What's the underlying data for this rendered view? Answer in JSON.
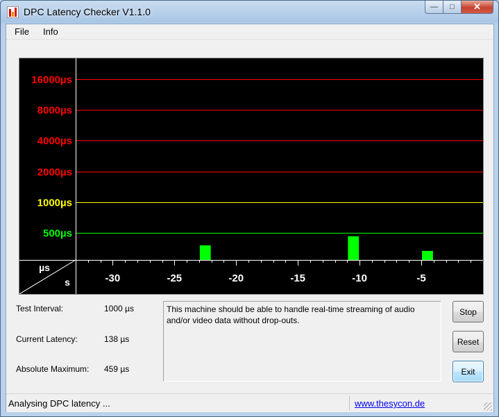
{
  "window": {
    "title": "DPC Latency Checker V1.1.0"
  },
  "caption_buttons": {
    "minimize": "—",
    "maximize": "□",
    "close": "✕"
  },
  "menu": [
    {
      "label": "File"
    },
    {
      "label": "Info"
    }
  ],
  "chart_data": {
    "type": "bar",
    "ylabel": "µs",
    "xlabel": "s",
    "y_scale": "log",
    "threshold_lines": [
      {
        "label": "16000µs",
        "value": 16000,
        "color": "#ff0000"
      },
      {
        "label": "8000µs",
        "value": 8000,
        "color": "#ff0000"
      },
      {
        "label": "4000µs",
        "value": 4000,
        "color": "#ff0000"
      },
      {
        "label": "2000µs",
        "value": 2000,
        "color": "#ff0000"
      },
      {
        "label": "1000µs",
        "value": 1000,
        "color": "#ffff00"
      },
      {
        "label": "500µs",
        "value": 500,
        "color": "#00ff00"
      }
    ],
    "x_ticks": [
      {
        "label": "-30",
        "value": -30
      },
      {
        "label": "-25",
        "value": -25
      },
      {
        "label": "-20",
        "value": -20
      },
      {
        "label": "-15",
        "value": -15
      },
      {
        "label": "-10",
        "value": -10
      },
      {
        "label": "-5",
        "value": -5
      }
    ],
    "x_range": [
      -33,
      0
    ],
    "bar_color": "#00ff00",
    "background": "#000000",
    "bars": [
      {
        "x": -32.5,
        "value": 220
      },
      {
        "x": -31.5,
        "value": 220
      },
      {
        "x": -30.5,
        "value": 210
      },
      {
        "x": -29.5,
        "value": 185
      },
      {
        "x": -28.5,
        "value": 210
      },
      {
        "x": -27.5,
        "value": 220
      },
      {
        "x": -26.5,
        "value": 200
      },
      {
        "x": -25.5,
        "value": 190
      },
      {
        "x": -24.5,
        "value": 195
      },
      {
        "x": -23.5,
        "value": 185
      },
      {
        "x": -22.5,
        "value": 380
      },
      {
        "x": -21.5,
        "value": 195
      },
      {
        "x": -20.5,
        "value": 195
      },
      {
        "x": -19.5,
        "value": 195
      },
      {
        "x": -18.5,
        "value": 200
      },
      {
        "x": -17.5,
        "value": 210
      },
      {
        "x": -16.5,
        "value": 215
      },
      {
        "x": -15.5,
        "value": 205
      },
      {
        "x": -14.5,
        "value": 195
      },
      {
        "x": -13.5,
        "value": 200
      },
      {
        "x": -12.5,
        "value": 200
      },
      {
        "x": -11.5,
        "value": 215
      },
      {
        "x": -10.5,
        "value": 459
      },
      {
        "x": -9.5,
        "value": 200
      },
      {
        "x": -8.5,
        "value": 200
      },
      {
        "x": -7.5,
        "value": 195
      },
      {
        "x": -6.5,
        "value": 190
      },
      {
        "x": -5.5,
        "value": 195
      },
      {
        "x": -4.5,
        "value": 330
      },
      {
        "x": -3.5,
        "value": 215
      },
      {
        "x": -2.5,
        "value": 205
      },
      {
        "x": -1.5,
        "value": 195
      },
      {
        "x": -0.5,
        "value": 200
      }
    ]
  },
  "stats": {
    "test_interval": {
      "label": "Test Interval:",
      "value": "1000 µs"
    },
    "current_latency": {
      "label": "Current Latency:",
      "value": "138 µs"
    },
    "absolute_maximum": {
      "label": "Absolute Maximum:",
      "value": "459 µs"
    }
  },
  "message": "This machine should be able to handle real-time streaming of audio and/or video data without drop-outs.",
  "buttons": {
    "stop": "Stop",
    "reset": "Reset",
    "exit": "Exit"
  },
  "status": {
    "text": "Analysing DPC latency ...",
    "link": "www.thesycon.de"
  }
}
